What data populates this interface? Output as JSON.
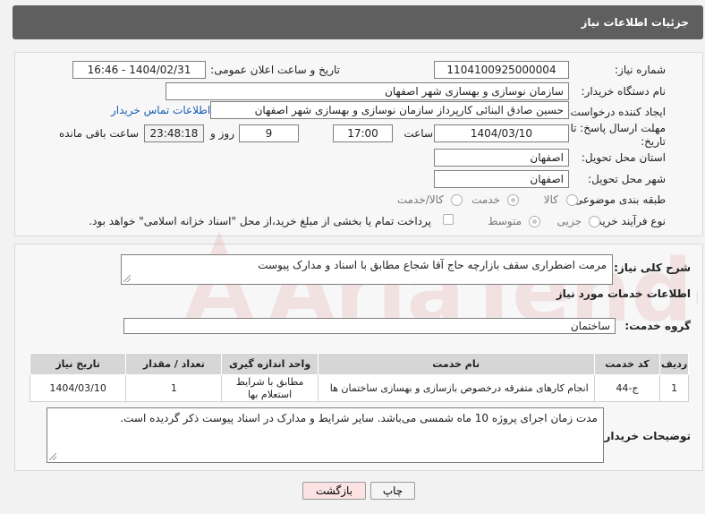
{
  "header": {
    "title": "جزئیات اطلاعات نیاز"
  },
  "form": {
    "need_number_label": "شماره نیاز:",
    "need_number": "1104100925000004",
    "announce_label": "تاریخ و ساعت اعلان عمومی:",
    "announce_value": "1404/02/31 - 16:46",
    "buyer_org_label": "نام دستگاه خریدار:",
    "buyer_org": "سازمان نوسازی و بهسازی شهر اصفهان",
    "creator_label": "ایجاد کننده درخواست:",
    "creator": "حسین صادق البنائی کارپرداز سازمان نوسازی و بهسازی شهر اصفهان",
    "contact_link": "اطلاعات تماس خریدار",
    "deadline_label_1": "مهلت ارسال پاسخ: تا",
    "deadline_label_2": "تاریخ:",
    "deadline_date": "1404/03/10",
    "time_label": "ساعت",
    "deadline_time": "17:00",
    "days_value": "9",
    "days_label": "روز و",
    "remaining_time": "23:48:18",
    "remaining_label": "ساعت باقی مانده",
    "province_label": "استان محل تحویل:",
    "province": "اصفهان",
    "city_label": "شهر محل تحویل:",
    "city": "اصفهان",
    "category_label": "طبقه بندی موضوعی:",
    "category_options": [
      "کالا",
      "خدمت",
      "کالا/خدمت"
    ],
    "process_label": "نوع فرآیند خرید :",
    "process_options": [
      "جزیی",
      "متوسط"
    ],
    "payment_note": "پرداخت تمام یا بخشی از مبلغ خرید،از محل \"اسناد خزانه اسلامی\" خواهد بود."
  },
  "summary": {
    "label": "شرح کلی نیاز:",
    "text": "مرمت اضطراری سقف بازارچه حاج آقا شجاع مطابق با اسناد و مدارک پیوست"
  },
  "services": {
    "section_title": "اطلاعات خدمات مورد نیاز",
    "group_label": "گروه خدمت:",
    "group_value": "ساختمان",
    "columns": [
      "ردیف",
      "کد خدمت",
      "نام خدمت",
      "واحد اندازه گیری",
      "تعداد / مقدار",
      "تاریخ نیاز"
    ],
    "rows": [
      {
        "row": "1",
        "code": "ج-44",
        "name": "انجام کارهای متفرقه درخصوص بازسازی و بهسازی ساختمان ها",
        "unit": "مطابق با شرایط استعلام بها",
        "qty": "1",
        "date": "1404/03/10"
      }
    ]
  },
  "buyer_notes": {
    "label": "توضیحات خریدار:",
    "text": "مدت زمان اجرای پروژه 10 ماه شمسی می‌باشد. سایر شرایط و مدارک در اسناد پیوست ذکر گردیده است."
  },
  "buttons": {
    "print": "چاپ",
    "back": "بازگشت"
  },
  "watermark": {
    "text": "AriaTender.neT"
  }
}
